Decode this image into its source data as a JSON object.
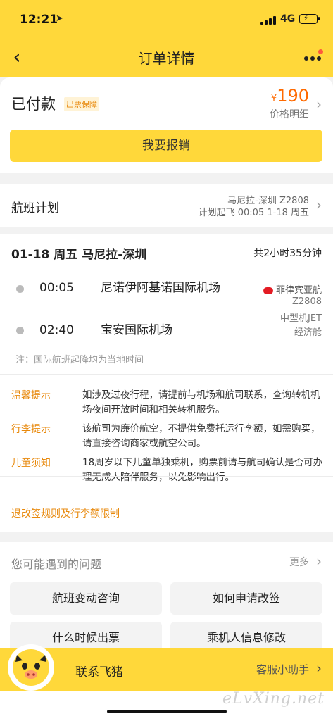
{
  "status_bar": {
    "time": "12:21",
    "network": "4G"
  },
  "nav": {
    "title": "订单详情"
  },
  "order": {
    "status": "已付款",
    "badge": "出票保障",
    "currency": "¥",
    "price": "190",
    "price_detail": "价格明细",
    "reimburse_button": "我要报销"
  },
  "flight_plan": {
    "label": "航班计划",
    "route_flight": "马尼拉-深圳 Z2808",
    "schedule": "计划起飞 00:05 1-18 周五"
  },
  "flight": {
    "header": "01-18 周五 马尼拉-深圳",
    "duration": "共2小时35分钟",
    "depart_time": "00:05",
    "depart_airport": "尼诺伊阿基诺国际机场",
    "arrive_time": "02:40",
    "arrive_airport": "宝安国际机场",
    "airline": "菲律宾亚航",
    "flight_no": "Z2808",
    "aircraft": "中型机JET",
    "cabin": "经济舱",
    "note": "注：国际航班起降均为当地时间"
  },
  "tips": [
    {
      "key": "温馨提示",
      "text": "如涉及过夜行程，请提前与机场和航司联系，查询转机机场夜间开放时间和相关转机服务。"
    },
    {
      "key": "行李提示",
      "text": "该航司为廉价航空，不提供免费托运行李额，如需购买，请直接咨询商家或航空公司。"
    },
    {
      "key": "儿童须知",
      "text": "18周岁以下儿童单独乘机，购票前请与航司确认是否可办理无成人陪伴服务，以免影响出行。"
    }
  ],
  "rules_link": "退改签规则及行李额限制",
  "faq": {
    "title": "您可能遇到的问题",
    "more": "更多",
    "questions": [
      "航班变动咨询",
      "如何申请改签",
      "什么时候出票",
      "乘机人信息修改"
    ]
  },
  "bottom_bar": {
    "contact": "联系飞猪",
    "assistant": "客服小助手"
  },
  "watermark": "eLvXing.net",
  "colors": {
    "brand_yellow": "#ffd83a",
    "accent_orange": "#e8890c",
    "price_orange": "#ff6a00"
  }
}
